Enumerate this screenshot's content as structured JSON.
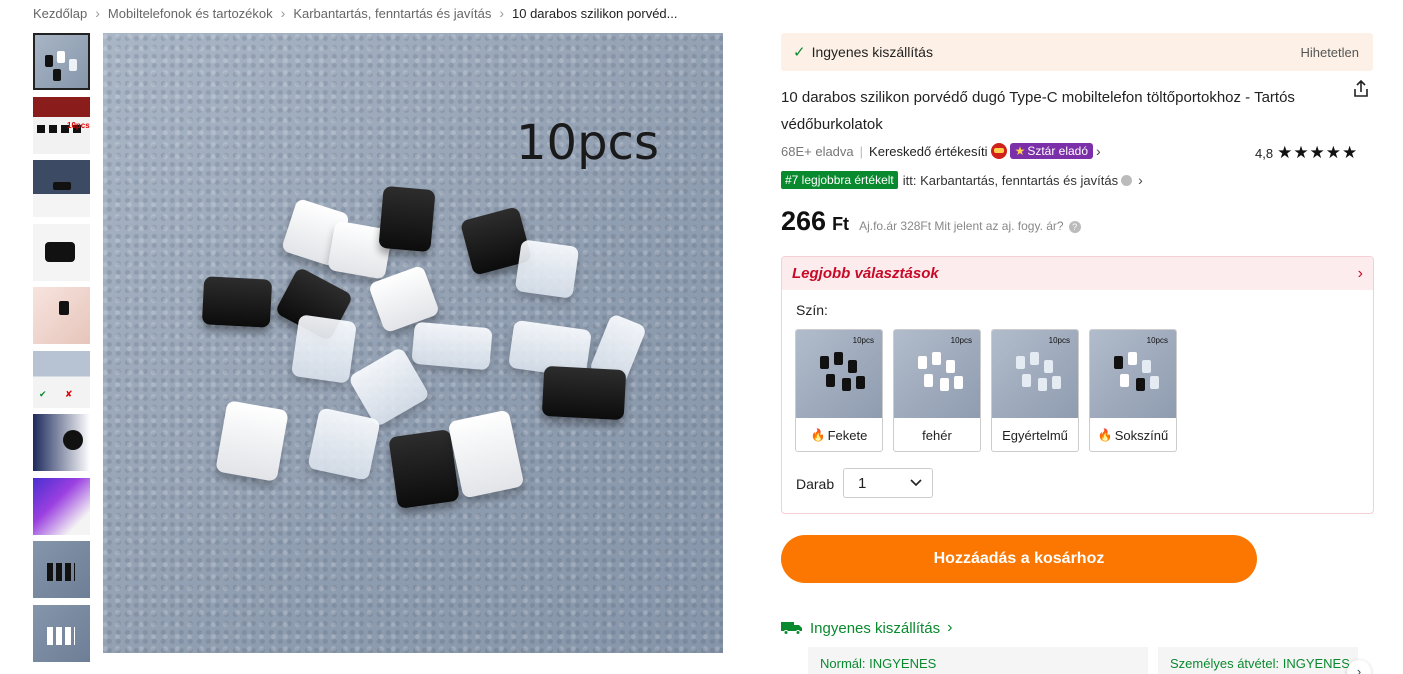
{
  "breadcrumb": {
    "items": [
      "Kezdőlap",
      "Mobiltelefonok és tartozékok",
      "Karbantartás, fenntartás és javítás",
      "10 darabos szilikon porvéd..."
    ]
  },
  "gallery": {
    "thumbnail_count": 10,
    "hero_label": "10pcs"
  },
  "shipping_bar": {
    "label": "Ingyenes kiszállítás",
    "right": "Hihetetlen"
  },
  "product": {
    "title": "10 darabos szilikon porvédő dugó Type-C mobiltelefon töltőportokhoz - Tartós védőburkolatok",
    "sold": "68E+ eladva",
    "seller_rating_label": "Kereskedő értékesíti",
    "star_seller": "Sztár eladó",
    "rating": "4,8",
    "rank_badge": "#7 legjobbra értékelt",
    "rank_text": "itt: Karbantartás, fenntartás és javítás",
    "price": "266",
    "currency": "Ft",
    "ref_price": "Aj.fo.ár 328Ft Mit jelent az aj. fogy. ár?"
  },
  "best_choices": {
    "title": "Legjobb választások",
    "color_label": "Szín:",
    "swatches": [
      {
        "name": "Fekete",
        "hot": true,
        "tag": "10pcs"
      },
      {
        "name": "fehér",
        "hot": false,
        "tag": "10pcs"
      },
      {
        "name": "Egyértelmű",
        "hot": false,
        "tag": "10pcs"
      },
      {
        "name": "Sokszínű",
        "hot": true,
        "tag": "10pcs"
      }
    ],
    "qty_label": "Darab",
    "qty_value": "1"
  },
  "cart": {
    "add_label": "Hozzáadás a kosárhoz"
  },
  "delivery": {
    "title": "Ingyenes kiszállítás",
    "options": [
      "Normál: INGYENES",
      "Személyes átvétel: INGYENES"
    ]
  },
  "colors": {
    "accent": "#fb7701",
    "green": "#0a8a2f",
    "red": "#c80a28",
    "purple": "#7b2fa8"
  }
}
